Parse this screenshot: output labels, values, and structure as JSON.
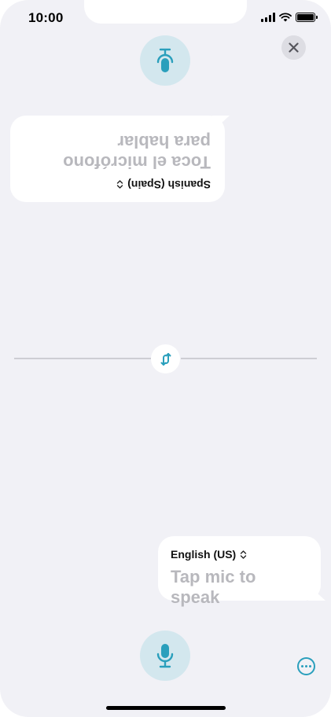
{
  "status_bar": {
    "time": "10:00"
  },
  "top_panel": {
    "language": "Spanish (Spain)",
    "prompt": "Toca el micrófono para hablar"
  },
  "bottom_panel": {
    "language": "English (US)",
    "prompt": "Tap mic to speak"
  },
  "colors": {
    "accent": "#2a9fbc",
    "mic_background": "#d3e7ee",
    "screen_background": "#f1f1f6",
    "placeholder_text": "#b8b8bd"
  },
  "icons": {
    "close": "close-icon",
    "mic": "microphone-icon",
    "swap": "swap-arrows-icon",
    "more": "more-options-icon"
  }
}
